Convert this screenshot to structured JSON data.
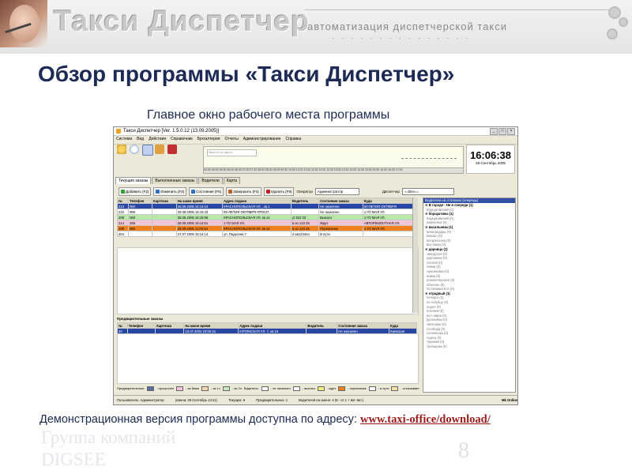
{
  "header": {
    "brand": "Такси Диспетчер",
    "tagline": "автоматизация диспетчерской такси"
  },
  "slide": {
    "title": "Обзор программы «Такси Диспетчер»",
    "subtitle": "Главное окно рабочего места программы",
    "demo_text": "Демонстрационная версия программы доступна по адресу: ",
    "demo_link": "www.taxi-office/download/",
    "company_line1": "Группа компаний",
    "company_line2": "DIGSEE",
    "page_number": "8"
  },
  "app": {
    "window_title": "Такси Диспетчер [Ver. 1.5.0.12  (13.09.2005)]",
    "menu": [
      "Система",
      "Вид",
      "Действия",
      "Справочник",
      "Бухгалтерия",
      "Отчеты",
      "Администрирование",
      "Справка"
    ],
    "search_placeholder": "Ввести на адрес",
    "timeline_ticks": "04:30 05:00 05:30 06:00 06:30 07:00 07:30 08:00 08:30 09:00 09:30 10:00 10:30 11:00 11:30 12:00 12:30 13:00 13:30 14:00 14:30 15:00 15:30 16:00 16:30 17:00",
    "clock_time": "16:06:38",
    "clock_date": "28 Сентябрь 2005",
    "tabs": [
      "Текущие заказы",
      "Выполненные заказы",
      "Водители",
      "Карта"
    ],
    "actions": {
      "add": "Добавить (F2)",
      "edit": "Изменить (F3)",
      "state": "Состояние (F5)",
      "finish": "Завершить (F4)",
      "delete": "Удалить (F8)"
    },
    "operator_label": "Оператор",
    "operator_value": "Администратор",
    "dispatcher_label": "Диспетчер",
    "dispatcher_value": "==Все==",
    "orders": {
      "columns": [
        "№",
        "Телефон",
        "Карточка",
        "На какое время",
        "Адрес подачи",
        "Водитель",
        "Состояние заказа",
        "Куда"
      ],
      "rows": [
        {
          "style": "sel",
          "cells": [
            "213",
            "060",
            "",
            "28.09.2005 16:14:24",
            "КРАСНОПОЛЬСКАЯ УЛ. , кв.1",
            "",
            "Не назначен",
            "50-ЛЕТИЯ ОКТЯБРЯ"
          ]
        },
        {
          "style": "",
          "cells": [
            "215",
            "999",
            "",
            "28.09.2005 16:15:43",
            "50-ЛЕТИЯ ОКТЯБРЯ ПРОСП.",
            "",
            "Не назначен",
            "1 ГО МАЯ УЛ."
          ]
        },
        {
          "style": "green",
          "cells": [
            "209",
            "060",
            "",
            "28.09.2005 16:15:59",
            "КРАСНОПОЛЬСКАЯ УЛ. кв.14",
            "у/ 322 33",
            "Выехал",
            "1 ГО МАЯ УЛ."
          ]
        },
        {
          "style": "pink",
          "cells": [
            "214",
            "256",
            "",
            "28.09.2005 16:14:51",
            "1 ГО МАЯ УЛ.",
            "в оо 123 45",
            "Ждет",
            "АВТОРЕМОНТНАЯ УЛ."
          ]
        },
        {
          "style": "orange",
          "cells": [
            "209",
            "060",
            "",
            "28.09.2005 11:04:10",
            "КРАСНОПОЛЬСКАЯ УЛ. кв.14",
            "в оо 123 45",
            "Перевозчик",
            "1 ГО МАЯ УЛ."
          ]
        },
        {
          "style": "",
          "cells": [
            "204",
            "",
            "",
            "27.07.2005 15:14:14",
            "ул. Падьгина 7",
            "4 ав1234оо",
            "В пути",
            ""
          ]
        }
      ]
    },
    "stands_header": "Водители на стоянках (очередь)",
    "stands": [
      {
        "grp": true,
        "label": "В городе - Не в очереди (1)"
      },
      {
        "grp": false,
        "label": "Борщагивский (0)"
      },
      {
        "grp": true,
        "label": "борщаговка (1)"
      },
      {
        "grp": false,
        "label": "Борщагивский (0)"
      },
      {
        "grp": false,
        "label": "Шевченка (0)"
      },
      {
        "grp": true,
        "label": "васильевка (1)"
      },
      {
        "grp": false,
        "label": "виноградарь (0)"
      },
      {
        "grp": false,
        "label": "Вокзал (0)"
      },
      {
        "grp": false,
        "label": "воскресенка (0)"
      },
      {
        "grp": false,
        "label": "выставка (0)"
      },
      {
        "grp": true,
        "label": "дарница (1)"
      },
      {
        "grp": false,
        "label": "заводская (0)"
      },
      {
        "grp": false,
        "label": "куреневка (0)"
      },
      {
        "grp": false,
        "label": "лесной (0)"
      },
      {
        "grp": false,
        "label": "липки (0)"
      },
      {
        "grp": false,
        "label": "лукьяновка (0)"
      },
      {
        "grp": false,
        "label": "нивки (0)"
      },
      {
        "grp": false,
        "label": "новопечерские (0)"
      },
      {
        "grp": false,
        "label": "оболонь (0)"
      },
      {
        "grp": false,
        "label": "Остановка К.О (0)"
      },
      {
        "grp": true,
        "label": "отрадный (1)"
      },
      {
        "grp": false,
        "label": "печерск (0)"
      },
      {
        "grp": false,
        "label": "по голубцу (0)"
      },
      {
        "grp": false,
        "label": "подол (0)"
      },
      {
        "grp": false,
        "label": "позняки (0)"
      },
      {
        "grp": false,
        "label": "пр-т мира (0)"
      },
      {
        "grp": false,
        "label": "русановка (0)"
      },
      {
        "grp": false,
        "label": "святошин (0)"
      },
      {
        "grp": false,
        "label": "Слобода (0)"
      },
      {
        "grp": false,
        "label": "соломенка (0)"
      },
      {
        "grp": false,
        "label": "сырец (0)"
      },
      {
        "grp": false,
        "label": "теремки (0)"
      },
      {
        "grp": false,
        "label": "троещина (0)"
      }
    ],
    "pre_title": "Предварительные заказы",
    "pre_orders": {
      "columns": [
        "№",
        "Телефон",
        "Карточка",
        "На какое время",
        "Адрес подачи",
        "Водитель",
        "Состояние заказа",
        "Куда"
      ],
      "rows": [
        {
          "style": "sel",
          "cells": [
            "40",
            "",
            "",
            "10.07.2004 23:00:15",
            "КУПЯНСКАЯ УЛ. 7, кв.16",
            "",
            "Не назначен",
            "Киевская"
          ]
        }
      ]
    },
    "legend": {
      "title": "Предварительные:",
      "items": [
        {
          "label": "- просрочен",
          "color": "#5a6fa0"
        },
        {
          "label": "- за 6мин",
          "color": "#f6c6e0"
        },
        {
          "label": "- за 1ч",
          "color": "#f8d8b0"
        },
        {
          "label": "- за 2ч",
          "color": "#c8e8c0"
        }
      ],
      "driver_title": "Водитель:",
      "driver_items": [
        {
          "label": "- не назначен",
          "color": "#ffffff"
        },
        {
          "label": "- выехал",
          "color": "#ffffff"
        },
        {
          "label": "- ждет",
          "color": "#f0f080"
        },
        {
          "label": "- перевозчик",
          "color": "#f08020"
        },
        {
          "label": "- в пути",
          "color": "#ffffff"
        },
        {
          "label": "- отказывает",
          "color": "#f8e0a0"
        }
      ]
    },
    "status": {
      "user": "Пользователь: Администратор",
      "time": "(смена: 28 Сентябрь 13:21)",
      "current": "Текущих: 6",
      "pre": "Предварительных: 1",
      "drivers": "Водителей на смене: 4 (8 - от 1 + 6кт.-5кт.)"
    },
    "tray": "Mk Online"
  }
}
